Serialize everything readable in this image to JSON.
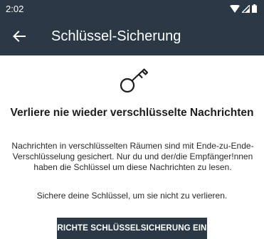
{
  "status_bar": {
    "time": "2:02",
    "icons": [
      "wifi-icon",
      "cell-signal-icon",
      "battery-icon"
    ]
  },
  "app_bar": {
    "back_icon": "arrow-back-icon",
    "title": "Schlüssel-Sicherung"
  },
  "main": {
    "icon": "key-icon",
    "headline": "Verliere nie wieder verschlüsselte Nachrichten",
    "description": "Nachrichten in verschlüsselten Räumen sind mit Ende-zu-Ende-Verschlüsselung gesichert. Nur du und der/die Empfänger!nnen haben die Schlüssel um diese Nachrichten zu lesen.",
    "hint": "Sichere deine Schlüssel, um sie nicht zu verlieren.",
    "button_label": "RICHTE SCHLÜSSELSICHERUNG EIN"
  },
  "colors": {
    "primary": "#2b3845",
    "background": "#ffffff",
    "text": "#1d1d1d"
  }
}
